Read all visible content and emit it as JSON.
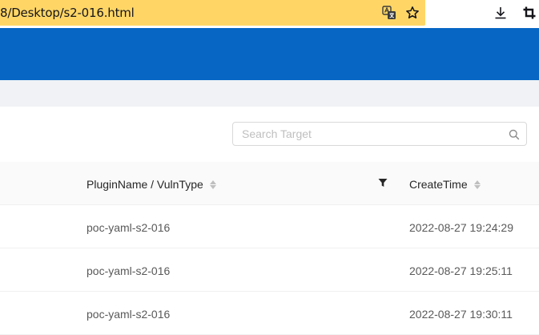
{
  "browser": {
    "url_text": "8/Desktop/s2-016.html"
  },
  "search": {
    "placeholder": "Search Target"
  },
  "table": {
    "columns": [
      {
        "label": "PluginName / VulnType"
      },
      {
        "label": "CreateTime"
      }
    ],
    "rows": [
      {
        "plugin": "poc-yaml-s2-016",
        "time": "2022-08-27 19:24:29"
      },
      {
        "plugin": "poc-yaml-s2-016",
        "time": "2022-08-27 19:25:11"
      },
      {
        "plugin": "poc-yaml-s2-016",
        "time": "2022-08-27 19:30:11"
      }
    ]
  },
  "colors": {
    "url_highlight": "#ffd666",
    "banner": "#0766c4",
    "band": "#f0f2f5"
  }
}
